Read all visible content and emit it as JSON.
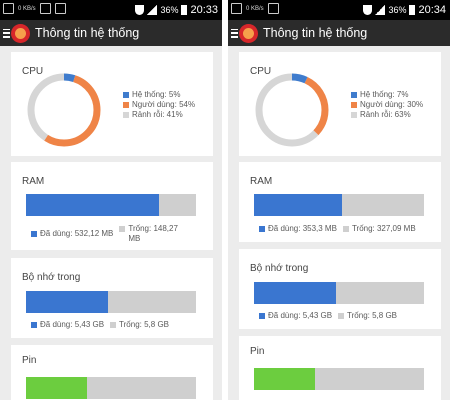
{
  "colors": {
    "system": "#3f7ccd",
    "user": "#ef8447",
    "idle": "#d6d6d6",
    "bar_used": "#3a76d0",
    "bar_free": "#cfcfcf",
    "battery": "#6ccd3f"
  },
  "icons": {
    "menu": "hamburger-icon",
    "logo": "ccleaner-logo-icon",
    "wifi": "wifi-icon",
    "signal": "signal-icon",
    "battery": "battery-icon"
  },
  "screens": [
    {
      "status": {
        "kbs": "0 KB/s",
        "battery": "36%",
        "time": "20:33"
      },
      "title": "Thông tin hệ thống",
      "cpu": {
        "label": "CPU",
        "system": 5,
        "user": 54,
        "idle": 41,
        "system_text": "Hệ thống: 5%",
        "user_text": "Người dùng: 54%",
        "idle_text": "Rảnh rỗi: 41%"
      },
      "ram": {
        "label": "RAM",
        "used_fraction": 0.78,
        "used_text": "Đã dùng: 532,12 MB",
        "free_text": "Trống: 148,27 MB"
      },
      "storage": {
        "label": "Bộ nhớ trong",
        "used_fraction": 0.48,
        "used_text": "Đã dùng: 5,43 GB",
        "free_text": "Trống: 5,8 GB"
      },
      "battery": {
        "label": "Pin",
        "level_fraction": 0.36
      }
    },
    {
      "status": {
        "kbs": "0 KB/s",
        "battery": "36%",
        "time": "20:34"
      },
      "title": "Thông tin hệ thống",
      "cpu": {
        "label": "CPU",
        "system": 7,
        "user": 30,
        "idle": 63,
        "system_text": "Hệ thống: 7%",
        "user_text": "Người dùng: 30%",
        "idle_text": "Rảnh rỗi: 63%"
      },
      "ram": {
        "label": "RAM",
        "used_fraction": 0.52,
        "used_text": "Đã dùng: 353,3 MB",
        "free_text": "Trống: 327,09 MB"
      },
      "storage": {
        "label": "Bộ nhớ trong",
        "used_fraction": 0.48,
        "used_text": "Đã dùng: 5,43 GB",
        "free_text": "Trống: 5,8 GB"
      },
      "battery": {
        "label": "Pin",
        "level_fraction": 0.36
      }
    }
  ]
}
